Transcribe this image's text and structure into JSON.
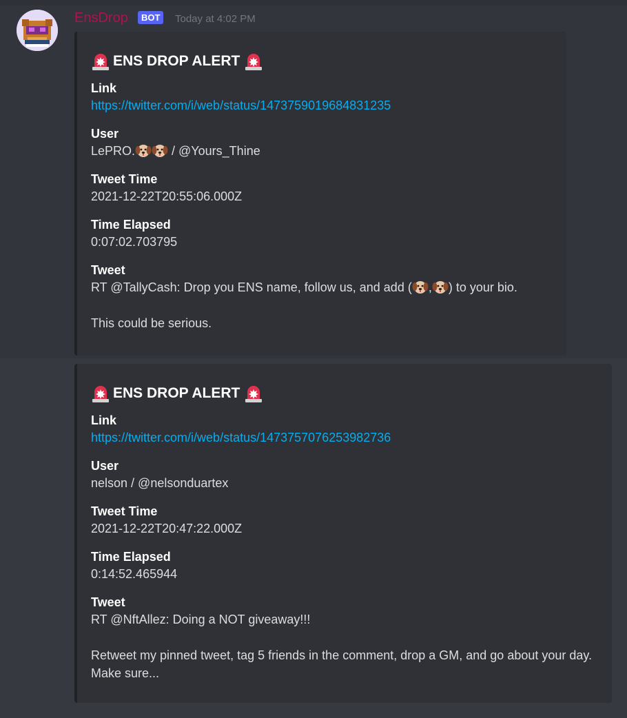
{
  "message": {
    "username": "EnsDrop",
    "badge": "BOT",
    "timestamp": "Today at 4:02 PM",
    "username_color": "#b0124e"
  },
  "embeds": [
    {
      "title": "ENS DROP ALERT",
      "link_label": "Link",
      "link": "https://twitter.com/i/web/status/1473759019684831235",
      "user_label": "User",
      "user_prefix": "LePRO.",
      "user_suffix": " / @Yours_Thine",
      "tweet_time_label": "Tweet Time",
      "tweet_time": "2021-12-22T20:55:06.000Z",
      "elapsed_label": "Time Elapsed",
      "elapsed": "0:07:02.703795",
      "tweet_label": "Tweet",
      "tweet_a": "RT @TallyCash: Drop you ENS name, follow us, and add (",
      "tweet_b": ",",
      "tweet_c": ") to your bio.",
      "tweet_d": "This could be serious."
    },
    {
      "title": "ENS DROP ALERT",
      "link_label": "Link",
      "link": "https://twitter.com/i/web/status/1473757076253982736",
      "user_label": "User",
      "user": "nelson / @nelsonduartex",
      "tweet_time_label": "Tweet Time",
      "tweet_time": "2021-12-22T20:47:22.000Z",
      "elapsed_label": "Time Elapsed",
      "elapsed": "0:14:52.465944",
      "tweet_label": "Tweet",
      "tweet_a": "RT @NftAllez: Doing a NOT giveaway!!!",
      "tweet_d": "Retweet my pinned tweet, tag 5 friends in the comment, drop a GM, and go about your day. Make sure..."
    }
  ],
  "icons": {
    "siren": "rotating-light-emoji",
    "dog": "dog-face-emoji",
    "avatar": "pixel-bot-avatar"
  },
  "colors": {
    "link": "#00aff4",
    "badge": "#5865f2",
    "embed_bg": "#2f3136",
    "chat_bg": "#36393f"
  }
}
